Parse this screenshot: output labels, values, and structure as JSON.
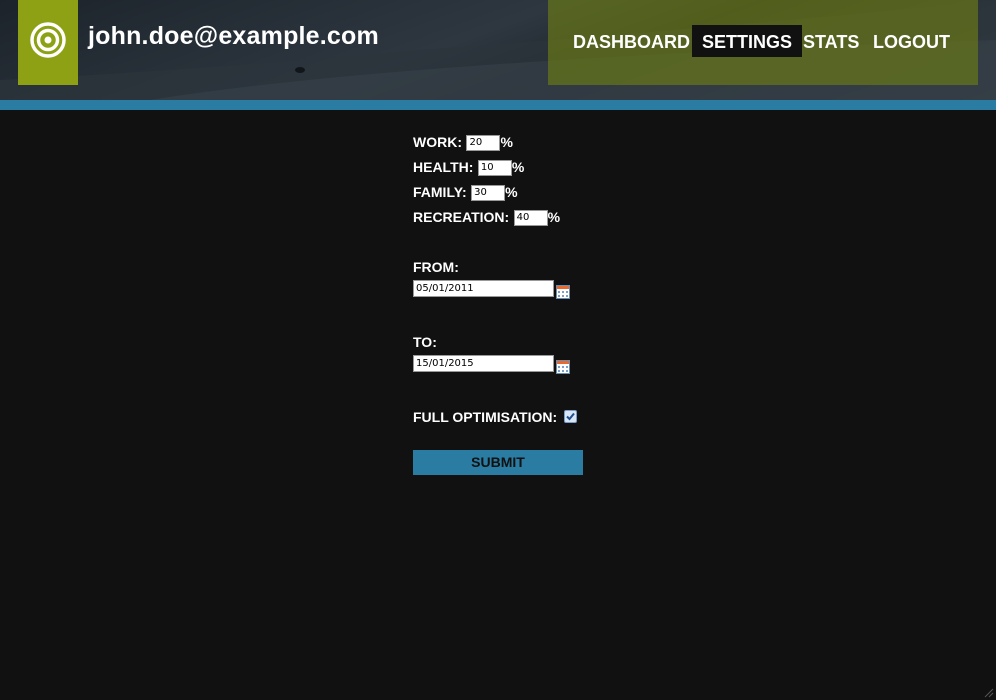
{
  "header": {
    "user_email": "john.doe@example.com",
    "logo_icon": "target-icon",
    "brand_color": "#8ea114",
    "accent_color": "#2a7ca3"
  },
  "nav": {
    "items": [
      {
        "label": "DASHBOARD",
        "active": false
      },
      {
        "label": "SETTINGS",
        "active": true
      },
      {
        "label": "STATS",
        "active": false
      },
      {
        "label": "LOGOUT",
        "active": false
      }
    ]
  },
  "form": {
    "work_label": "WORK:",
    "work_value": "20",
    "health_label": "HEALTH:",
    "health_value": "10",
    "family_label": "FAMILY:",
    "family_value": "30",
    "recreation_label": "RECREATION:",
    "recreation_value": "40",
    "percent_symbol": "%",
    "from_label": "FROM:",
    "from_value": "05/01/2011",
    "to_label": "TO:",
    "to_value": "15/01/2015",
    "calendar_icon": "calendar-icon",
    "full_optimisation_label": "FULL OPTIMISATION:",
    "full_optimisation_checked": true,
    "submit_label": "SUBMIT"
  }
}
